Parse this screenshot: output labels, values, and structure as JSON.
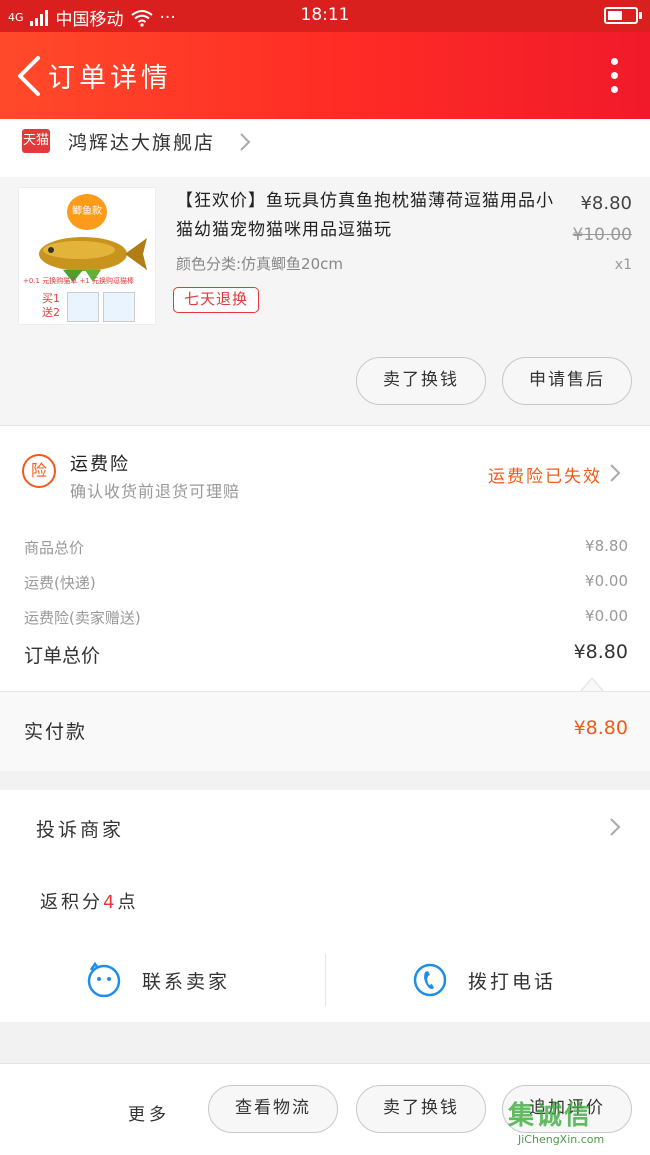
{
  "status_bar": {
    "network": "4G",
    "carrier": "中国移动",
    "dots": "···",
    "time": "18:11"
  },
  "header": {
    "title": "订单详情"
  },
  "shop": {
    "tmall_tag": "天猫",
    "name": "鸿辉达大旗舰店"
  },
  "product": {
    "title": "【狂欢价】鱼玩具仿真鱼抱枕猫薄荷逗猫用品小猫幼猫宠物猫咪用品逗猫玩",
    "spec": "颜色分类:仿真鲫鱼20cm",
    "price": "¥8.80",
    "original_price": "¥10.00",
    "quantity": "x1",
    "return_badge": "七天退换",
    "image_text": {
      "tag": "鲫鱼款",
      "buy_gift": "买1送2",
      "plus_text": "+0.1 元换购猫草  +1 元换购逗猫棒"
    }
  },
  "product_actions": {
    "return_label": "卖了换钱",
    "after_sale_label": "申请售后"
  },
  "insurance": {
    "icon_text": "险",
    "name": "运费险",
    "desc": "确认收货前退货可理赔",
    "status": "运费险已失效"
  },
  "costs": {
    "rows": [
      {
        "label": "商品总价",
        "value": "¥8.80"
      },
      {
        "label": "运费(快递)",
        "value": "¥0.00"
      },
      {
        "label": "运费险(卖家赠送)",
        "value": "¥0.00"
      }
    ],
    "total_label": "订单总价",
    "total_value": "¥8.80"
  },
  "paid": {
    "label": "实付款",
    "value": "¥8.80"
  },
  "complain": {
    "label": "投诉商家"
  },
  "points": {
    "prefix": "返积分",
    "num": "4",
    "suffix": "点"
  },
  "contact": {
    "seller_label": "联系卖家",
    "phone_label": "拨打电话"
  },
  "bottom_bar": {
    "more_label": "更多",
    "logistics_label": "查看物流",
    "return_label": "卖了换钱",
    "review_label": "追加评价"
  },
  "watermark": {
    "main": "集诚信",
    "sub": "JiChengXin.com"
  },
  "colors": {
    "brand_red": "#d9201f",
    "accent_orange": "#f25a1b",
    "tmall_red": "#e4393c"
  }
}
